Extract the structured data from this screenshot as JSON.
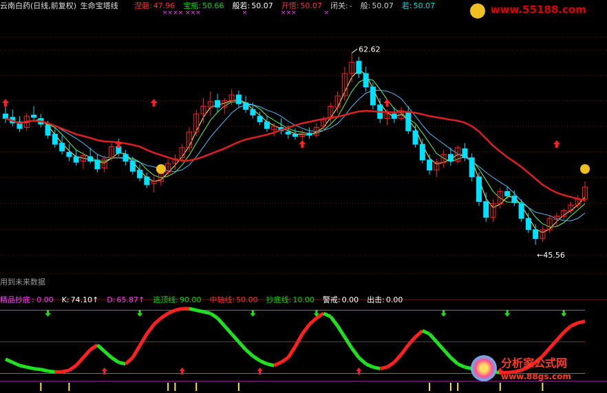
{
  "header": {
    "stock": "云南白药(日线,前复权)",
    "indicator": "生命宝塔线",
    "items": [
      {
        "label": "涅磐:",
        "value": "47.96",
        "color": "#ff3030"
      },
      {
        "label": "宝瓶:",
        "value": "50.66",
        "color": "#00e000"
      },
      {
        "label": "般若:",
        "value": "50.07",
        "color": "#ffffff"
      },
      {
        "label": "开悟:",
        "value": "50.07",
        "color": "#ff3030"
      },
      {
        "label": "闭关:",
        "value": "-",
        "color": "#cccccc"
      },
      {
        "label": "般:",
        "value": "50.07",
        "color": "#cccccc"
      },
      {
        "label": "若:",
        "value": "50.07",
        "color": "#00e0e0"
      }
    ],
    "future_note": "用到未来数据"
  },
  "sub_header": {
    "items": [
      {
        "label": "精品抄底",
        "value": ": 0.00",
        "color": "#ff40ff"
      },
      {
        "label": "K:",
        "value": "74.10↑",
        "color": "#ffffff"
      },
      {
        "label": "D:",
        "value": "65.87↑",
        "color": "#ff40ff"
      },
      {
        "label": "逃顶线:",
        "value": "90.00",
        "color": "#00e000"
      },
      {
        "label": "中轴线:",
        "value": "50.00",
        "color": "#ff3030"
      },
      {
        "label": "抄底线:",
        "value": "10.00",
        "color": "#00e000"
      },
      {
        "label": "警戒:",
        "value": "0.00",
        "color": "#ffffff"
      },
      {
        "label": "出击:",
        "value": "0.00",
        "color": "#ffffff"
      }
    ]
  },
  "annotations": {
    "high": "62.62",
    "low": "45.56"
  },
  "watermarks": {
    "top": "www.55188.com",
    "bottom_cn": "分析家公式网",
    "bottom_url": "www.88gs.com"
  },
  "colors": {
    "up": "#ff2020",
    "down": "#00e0ff",
    "ma_slow": "#e02020",
    "green": "#00e000"
  },
  "chart_data": [
    {
      "type": "candlestick",
      "title": "生命宝塔线",
      "ylim": [
        43,
        66
      ],
      "candles": [
        [
          57.2,
          57.9,
          56.4,
          56.8
        ],
        [
          56.9,
          57.6,
          56.1,
          56.4
        ],
        [
          56.5,
          57.0,
          55.6,
          55.9
        ],
        [
          56.0,
          57.3,
          55.7,
          57.0
        ],
        [
          57.1,
          57.9,
          56.5,
          56.9
        ],
        [
          56.8,
          57.2,
          56.0,
          56.3
        ],
        [
          56.2,
          56.6,
          55.0,
          55.3
        ],
        [
          55.4,
          56.0,
          54.2,
          54.5
        ],
        [
          54.6,
          55.3,
          53.6,
          53.9
        ],
        [
          53.8,
          54.5,
          53.0,
          53.4
        ],
        [
          53.4,
          54.0,
          52.6,
          52.9
        ],
        [
          53.0,
          53.8,
          52.3,
          53.5
        ],
        [
          53.4,
          54.2,
          52.8,
          53.0
        ],
        [
          53.1,
          53.6,
          52.0,
          52.3
        ],
        [
          52.4,
          53.5,
          52.0,
          53.2
        ],
        [
          53.3,
          54.6,
          53.0,
          54.3
        ],
        [
          54.3,
          55.0,
          53.4,
          53.7
        ],
        [
          53.6,
          54.0,
          52.6,
          53.0
        ],
        [
          53.0,
          53.4,
          51.8,
          52.1
        ],
        [
          52.2,
          52.7,
          51.2,
          51.5
        ],
        [
          51.6,
          52.0,
          50.6,
          50.9
        ],
        [
          51.0,
          51.6,
          50.2,
          51.2
        ],
        [
          51.2,
          52.2,
          50.8,
          51.9
        ],
        [
          52.0,
          53.2,
          51.6,
          52.8
        ],
        [
          52.8,
          53.6,
          52.2,
          53.2
        ],
        [
          53.3,
          54.5,
          53.0,
          54.2
        ],
        [
          54.2,
          56.0,
          53.8,
          55.6
        ],
        [
          55.6,
          57.6,
          55.2,
          57.2
        ],
        [
          57.2,
          58.6,
          56.4,
          57.9
        ],
        [
          57.8,
          59.2,
          57.0,
          58.3
        ],
        [
          58.4,
          59.0,
          57.4,
          57.8
        ],
        [
          57.8,
          58.6,
          57.2,
          58.4
        ],
        [
          58.4,
          59.4,
          58.0,
          58.9
        ],
        [
          58.9,
          59.3,
          57.8,
          58.1
        ],
        [
          58.2,
          58.8,
          57.3,
          57.6
        ],
        [
          57.6,
          58.2,
          56.8,
          57.1
        ],
        [
          57.0,
          57.4,
          56.2,
          56.5
        ],
        [
          56.5,
          57.0,
          55.6,
          55.9
        ],
        [
          55.8,
          56.4,
          55.2,
          56.1
        ],
        [
          56.0,
          56.8,
          55.4,
          55.7
        ],
        [
          55.6,
          56.2,
          55.0,
          55.4
        ],
        [
          55.4,
          55.9,
          54.9,
          55.2
        ],
        [
          55.2,
          55.8,
          54.8,
          55.5
        ],
        [
          55.5,
          56.0,
          55.0,
          55.3
        ],
        [
          55.3,
          56.4,
          55.1,
          56.0
        ],
        [
          56.1,
          57.0,
          55.7,
          56.7
        ],
        [
          56.8,
          58.2,
          56.4,
          57.9
        ],
        [
          57.8,
          59.2,
          57.3,
          58.8
        ],
        [
          58.8,
          61.4,
          58.4,
          60.8
        ],
        [
          60.8,
          62.62,
          60.0,
          61.8
        ],
        [
          61.9,
          62.3,
          60.4,
          60.8
        ],
        [
          60.8,
          61.4,
          59.2,
          59.6
        ],
        [
          59.6,
          60.0,
          57.6,
          58.0
        ],
        [
          58.0,
          58.6,
          56.4,
          56.8
        ],
        [
          56.8,
          57.6,
          56.2,
          57.2
        ],
        [
          57.2,
          57.8,
          56.4,
          56.8
        ],
        [
          56.8,
          57.8,
          56.6,
          57.5
        ],
        [
          57.4,
          57.9,
          55.4,
          55.7
        ],
        [
          55.7,
          56.2,
          54.2,
          54.5
        ],
        [
          54.5,
          55.0,
          52.8,
          53.1
        ],
        [
          53.1,
          53.6,
          51.8,
          52.2
        ],
        [
          52.2,
          53.2,
          51.6,
          52.9
        ],
        [
          52.9,
          54.0,
          52.4,
          53.6
        ],
        [
          53.6,
          54.2,
          52.6,
          53.0
        ],
        [
          53.0,
          54.4,
          52.8,
          54.2
        ],
        [
          54.1,
          54.6,
          53.0,
          53.3
        ],
        [
          53.3,
          53.7,
          51.2,
          51.6
        ],
        [
          51.6,
          52.0,
          49.0,
          49.4
        ],
        [
          49.4,
          50.2,
          47.6,
          48.0
        ],
        [
          48.0,
          49.6,
          47.6,
          49.2
        ],
        [
          49.2,
          50.6,
          48.8,
          50.3
        ],
        [
          50.3,
          50.8,
          49.6,
          49.9
        ],
        [
          49.9,
          50.4,
          49.0,
          49.3
        ],
        [
          49.2,
          49.6,
          47.6,
          47.9
        ],
        [
          47.9,
          48.4,
          46.6,
          46.9
        ],
        [
          46.9,
          47.4,
          45.56,
          46.1
        ],
        [
          46.1,
          47.2,
          45.8,
          46.9
        ],
        [
          46.9,
          48.2,
          46.6,
          47.9
        ],
        [
          47.8,
          48.4,
          47.2,
          48.1
        ],
        [
          48.1,
          48.8,
          47.8,
          48.6
        ],
        [
          48.6,
          49.4,
          48.3,
          49.1
        ],
        [
          49.1,
          50.0,
          48.8,
          49.6
        ],
        [
          49.6,
          51.2,
          49.3,
          50.7
        ]
      ],
      "up_arrows_at": [
        0,
        16,
        21,
        42,
        54,
        78
      ],
      "smiley_at": [
        22,
        82
      ]
    },
    {
      "type": "line",
      "title": "精品抄底",
      "ylim": [
        0,
        100
      ],
      "reference_lines": [
        {
          "name": "逃顶线",
          "value": 90
        },
        {
          "name": "中轴线",
          "value": 50
        },
        {
          "name": "抄底线",
          "value": 10
        }
      ],
      "K": [
        28,
        24,
        20,
        18,
        16,
        15,
        13,
        12,
        12,
        14,
        20,
        30,
        40,
        46,
        38,
        30,
        24,
        22,
        30,
        45,
        60,
        72,
        80,
        86,
        90,
        92,
        92,
        90,
        88,
        86,
        80,
        70,
        60,
        50,
        40,
        32,
        26,
        22,
        20,
        24,
        30,
        44,
        60,
        72,
        80,
        86,
        82,
        70,
        56,
        42,
        30,
        22,
        18,
        16,
        18,
        24,
        34,
        46,
        56,
        64,
        60,
        50,
        40,
        30,
        22,
        18,
        16,
        16,
        14,
        12,
        11,
        11,
        12,
        14,
        18,
        24,
        32,
        42,
        52,
        62,
        70,
        74,
        76
      ],
      "down_arrows_at": [
        6,
        19,
        35,
        44,
        62,
        71,
        79
      ],
      "up_arrows_at": [
        14,
        25,
        36,
        50,
        67,
        70
      ]
    }
  ]
}
